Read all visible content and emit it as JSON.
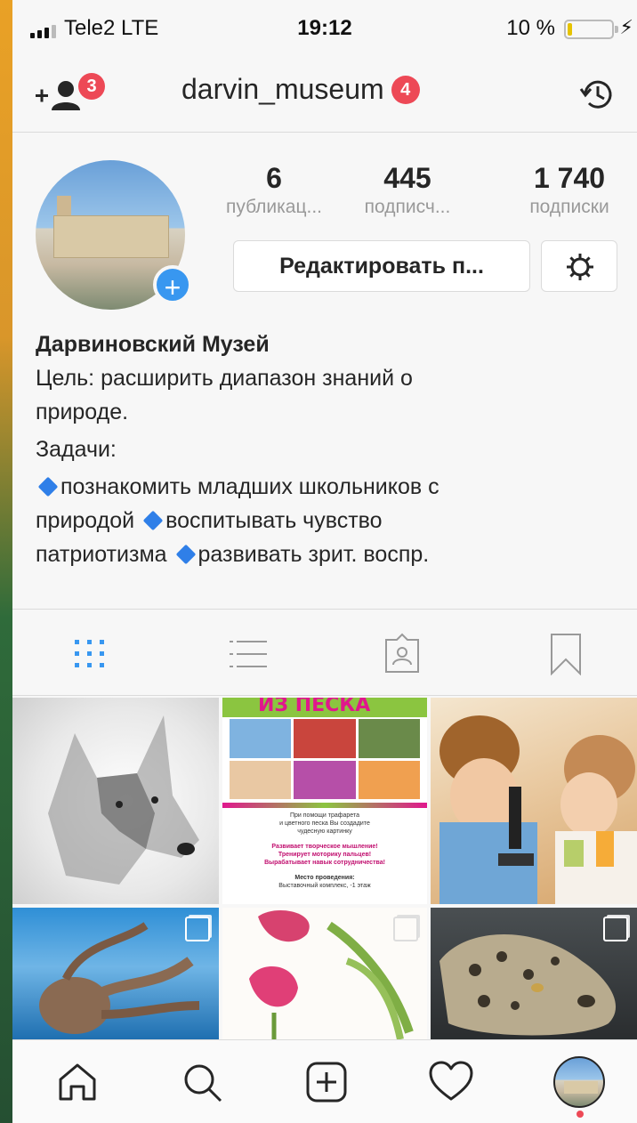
{
  "status_bar": {
    "carrier": "Tele2  LTE",
    "time": "19:12",
    "battery_percent": "10 %",
    "battery_level": 0.1,
    "battery_color": "#e6c300"
  },
  "header": {
    "username": "darvin_museum",
    "username_badge": "4",
    "add_user_badge": "3",
    "add_user_icon": "add-user-icon",
    "history_icon": "history-icon",
    "badge_color": "#ed4956"
  },
  "profile": {
    "stats": [
      {
        "value": "6",
        "label": "публикац..."
      },
      {
        "value": "445",
        "label": "подписч..."
      },
      {
        "value": "1 740",
        "label": "подписки"
      }
    ],
    "edit_button": "Редактировать п...",
    "settings_icon": "gear-icon",
    "bio": {
      "name": "Дарвиновский Музей",
      "line1": "Цель: расширить диапазон знаний о",
      "line2": "природе.",
      "line3": "Задачи:",
      "task1": "познакомить младших школьников с",
      "task1b": "природой",
      "task2": "воспитывать чувство",
      "task2b": "патриотизма",
      "task3": "развивать зрит. воспр."
    }
  },
  "tabs": [
    {
      "name": "grid",
      "icon": "grid-icon",
      "active": true
    },
    {
      "name": "list",
      "icon": "list-icon",
      "active": false
    },
    {
      "name": "tagged",
      "icon": "tagged-icon",
      "active": false
    },
    {
      "name": "saved",
      "icon": "bookmark-icon",
      "active": false
    }
  ],
  "posts": [
    {
      "subject": "wolf drawing"
    },
    {
      "subject": "sand art poster",
      "heading": "ИЗ ПЕСКА",
      "lines": [
        "При помощи трафарета",
        "и цветного песка Вы создадите",
        "чудесную картинку",
        "Развивает творческое мышление!",
        "Тренирует моторику пальцев!",
        "Вырабатывает навык сотрудничества!",
        "Место проведения:",
        "Выставочный комплекс, -1 этаж"
      ]
    },
    {
      "subject": "children with microscope"
    },
    {
      "subject": "octopus",
      "multi": true
    },
    {
      "subject": "tulips drawing",
      "multi": true
    },
    {
      "subject": "snow leopard",
      "multi": true
    }
  ],
  "bottom_nav": [
    {
      "icon": "home-icon"
    },
    {
      "icon": "search-icon"
    },
    {
      "icon": "add-post-icon"
    },
    {
      "icon": "heart-icon"
    },
    {
      "icon": "profile-avatar"
    }
  ],
  "accent_color": "#3897f0"
}
